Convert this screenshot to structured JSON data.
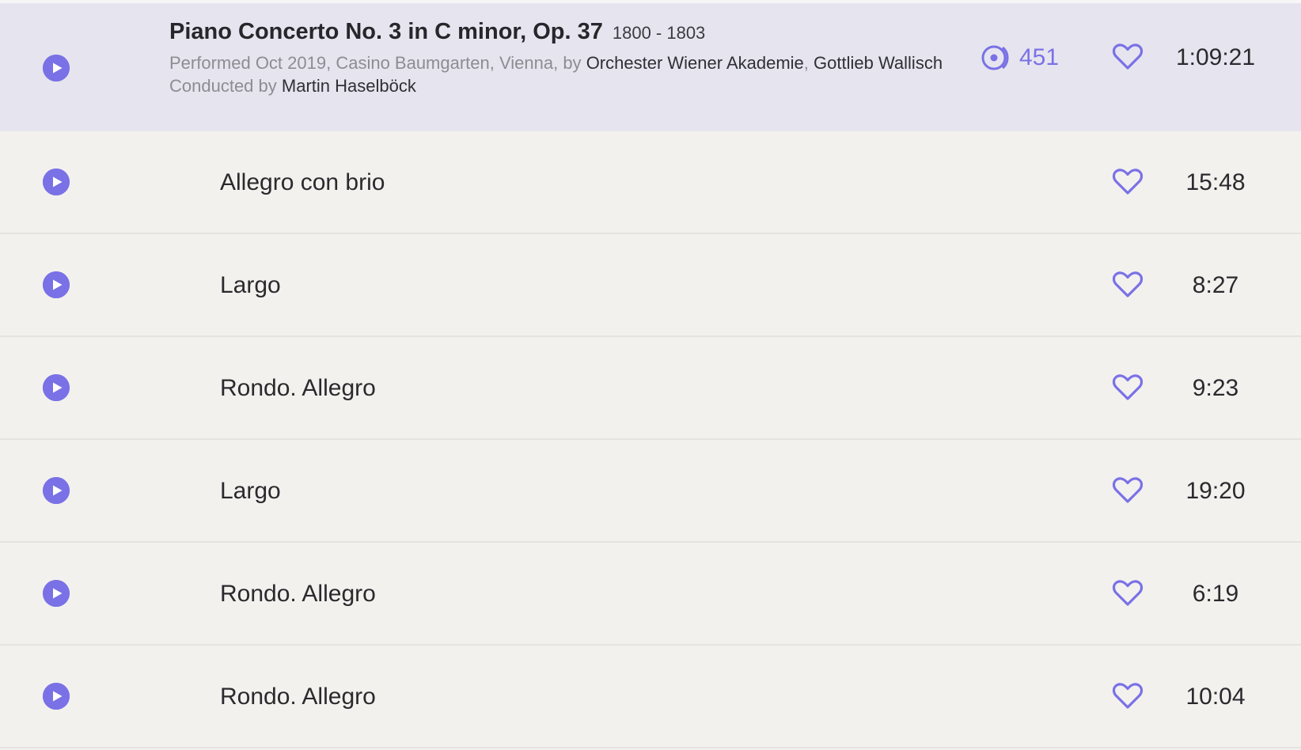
{
  "work": {
    "title": "Piano Concerto No. 3 in C minor, Op. 37",
    "years": "1800 - 1803",
    "performed_prefix": "Performed Oct 2019, Casino Baumgarten, Vienna, by",
    "performer_1": "Orchester Wiener Akademie",
    "performer_sep": ",",
    "performer_2": "Gottlieb Wallisch",
    "conducted_prefix": "Conducted by",
    "conductor": "Martin Haselböck",
    "listen_count": "451",
    "duration": "1:09:21"
  },
  "tracks": [
    {
      "title": "Allegro con brio",
      "duration": "15:48"
    },
    {
      "title": "Largo",
      "duration": "8:27"
    },
    {
      "title": "Rondo. Allegro",
      "duration": "9:23"
    },
    {
      "title": "Largo",
      "duration": "19:20"
    },
    {
      "title": "Rondo. Allegro",
      "duration": "6:19"
    },
    {
      "title": "Rondo. Allegro",
      "duration": "10:04"
    }
  ],
  "icons": {
    "play": "play-circle-icon",
    "heart": "heart-outline-icon",
    "listens": "listens-icon"
  },
  "colors": {
    "accent": "#7a71e6",
    "header_bg": "#e6e5ef",
    "row_bg": "#f2f1ee"
  }
}
